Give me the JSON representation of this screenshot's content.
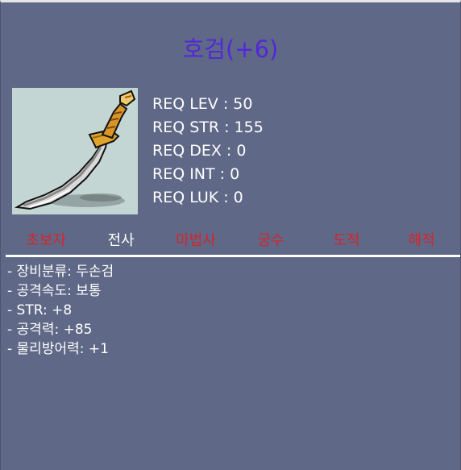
{
  "item": {
    "name": "호검(+6)",
    "icon": "curved-sword-icon"
  },
  "requirements": [
    "REQ LEV : 50",
    "REQ STR : 155",
    "REQ DEX : 0",
    "REQ INT : 0",
    "REQ LUK : 0"
  ],
  "jobs": [
    {
      "label": "초보자",
      "allowed": false
    },
    {
      "label": "전사",
      "allowed": true
    },
    {
      "label": "마법사",
      "allowed": false
    },
    {
      "label": "궁수",
      "allowed": false
    },
    {
      "label": "도적",
      "allowed": false
    },
    {
      "label": "해적",
      "allowed": false
    }
  ],
  "stats": [
    "- 장비분류: 두손검",
    "- 공격속도: 보통",
    "- STR: +8",
    "- 공격력: +85",
    "- 물리방어력: +1"
  ],
  "colors": {
    "background": "#5f6886",
    "title": "#5227d9",
    "job_allowed": "#ffffff",
    "job_disallowed": "#d4252c",
    "image_background": "#c4d6d3"
  }
}
